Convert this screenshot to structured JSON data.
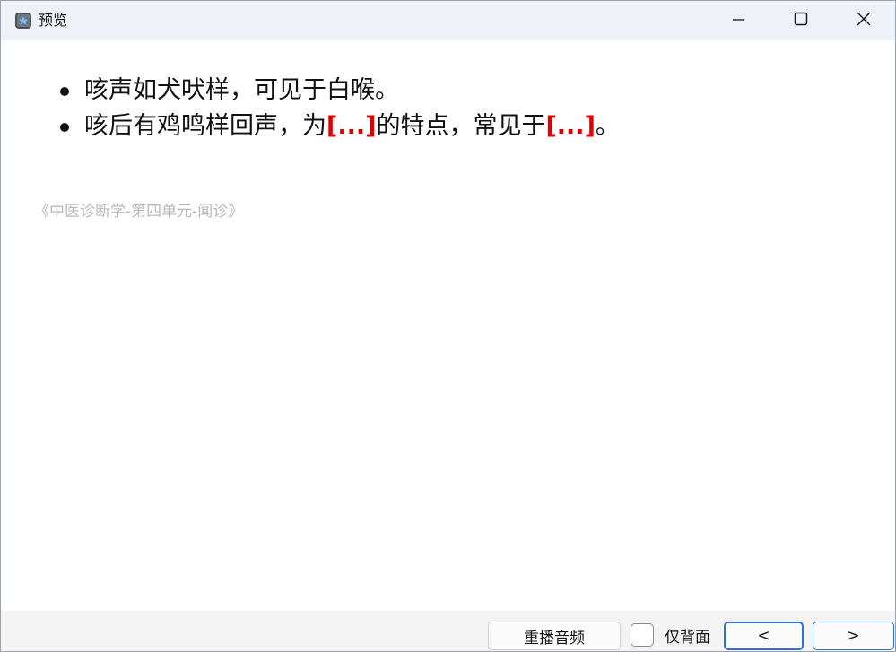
{
  "window": {
    "title": "预览",
    "app_icon": "app-icon",
    "controls": [
      "minimize-icon",
      "maximize-icon",
      "close-icon"
    ]
  },
  "card": {
    "lines": [
      {
        "segments": [
          {
            "text": "咳声如犬吠样，可见于白喉。",
            "cloze": false
          }
        ]
      },
      {
        "segments": [
          {
            "text": "咳后有鸡鸣样回声，为",
            "cloze": false
          },
          {
            "text": "[...]",
            "cloze": true
          },
          {
            "text": "的特点，常见于",
            "cloze": false
          },
          {
            "text": "[...]",
            "cloze": true
          },
          {
            "text": "。",
            "cloze": false
          }
        ]
      }
    ],
    "source": "《中医诊断学-第四单元-闻诊》"
  },
  "footer": {
    "replay_label": "重播音频",
    "back_only_label": "仅背面",
    "back_only_checked": false,
    "prev_label": "<",
    "next_label": ">"
  },
  "colors": {
    "cloze": "#e00000",
    "accent": "#2f6fd6"
  }
}
